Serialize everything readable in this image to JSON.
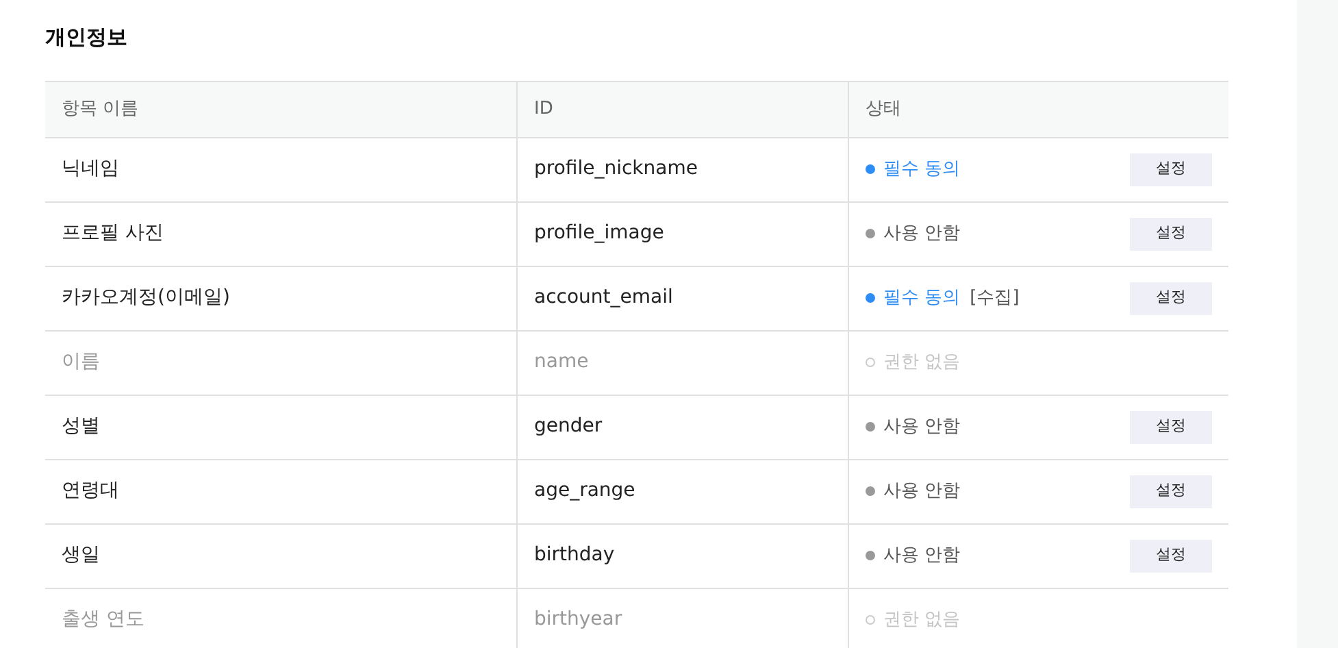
{
  "title": "개인정보",
  "columns": [
    "항목 이름",
    "ID",
    "상태"
  ],
  "rows": [
    {
      "name": "닉네임",
      "id": "profile_nickname",
      "status": "필수 동의",
      "kind": "required",
      "button": "설정"
    },
    {
      "name": "프로필 사진",
      "id": "profile_image",
      "status": "사용 안함",
      "kind": "unused",
      "button": "설정"
    },
    {
      "name": "카카오계정(이메일)",
      "id": "account_email",
      "status": "필수 동의",
      "note": "[수집]",
      "kind": "required",
      "button": "설정"
    },
    {
      "name": "이름",
      "id": "name",
      "status": "권한 없음",
      "kind": "none"
    },
    {
      "name": "성별",
      "id": "gender",
      "status": "사용 안함",
      "kind": "unused",
      "button": "설정"
    },
    {
      "name": "연령대",
      "id": "age_range",
      "status": "사용 안함",
      "kind": "unused",
      "button": "설정"
    },
    {
      "name": "생일",
      "id": "birthday",
      "status": "사용 안함",
      "kind": "unused",
      "button": "설정"
    },
    {
      "name": "출생 연도",
      "id": "birthyear",
      "status": "권한 없음",
      "kind": "none"
    }
  ]
}
